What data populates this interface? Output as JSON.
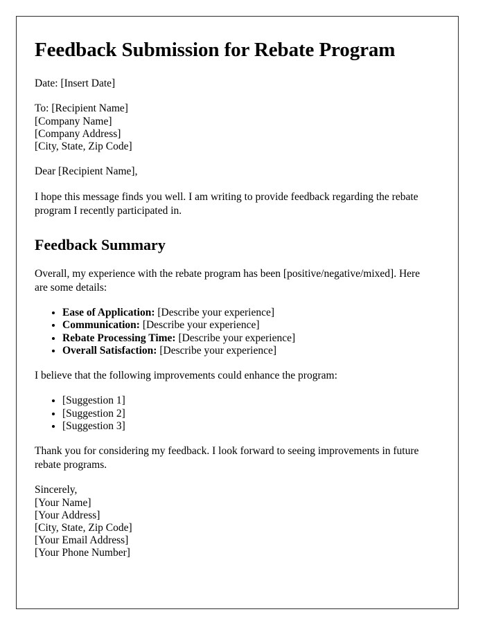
{
  "document": {
    "title": "Feedback Submission for Rebate Program",
    "date_line": "Date: [Insert Date]",
    "recipient_block": [
      "To: [Recipient Name]",
      "[Company Name]",
      "[Company Address]",
      "[City, State, Zip Code]"
    ],
    "salutation": "Dear [Recipient Name],",
    "intro_paragraph": "I hope this message finds you well. I am writing to provide feedback regarding the rebate program I recently participated in.",
    "summary_heading": "Feedback Summary",
    "summary_paragraph": "Overall, my experience with the rebate program has been [positive/negative/mixed]. Here are some details:",
    "detail_items": [
      {
        "label": "Ease of Application:",
        "value": "[Describe your experience]"
      },
      {
        "label": "Communication:",
        "value": "[Describe your experience]"
      },
      {
        "label": "Rebate Processing Time:",
        "value": "[Describe your experience]"
      },
      {
        "label": "Overall Satisfaction:",
        "value": "[Describe your experience]"
      }
    ],
    "improvements_intro": "I believe that the following improvements could enhance the program:",
    "suggestions": [
      "[Suggestion 1]",
      "[Suggestion 2]",
      "[Suggestion 3]"
    ],
    "closing_paragraph": "Thank you for considering my feedback. I look forward to seeing improvements in future rebate programs.",
    "signature_block": [
      "Sincerely,",
      "[Your Name]",
      "[Your Address]",
      "[City, State, Zip Code]",
      "[Your Email Address]",
      "[Your Phone Number]"
    ]
  },
  "style": {
    "border_color": "#2b2b2b",
    "text_color": "#000000",
    "page_background": "#ffffff"
  }
}
